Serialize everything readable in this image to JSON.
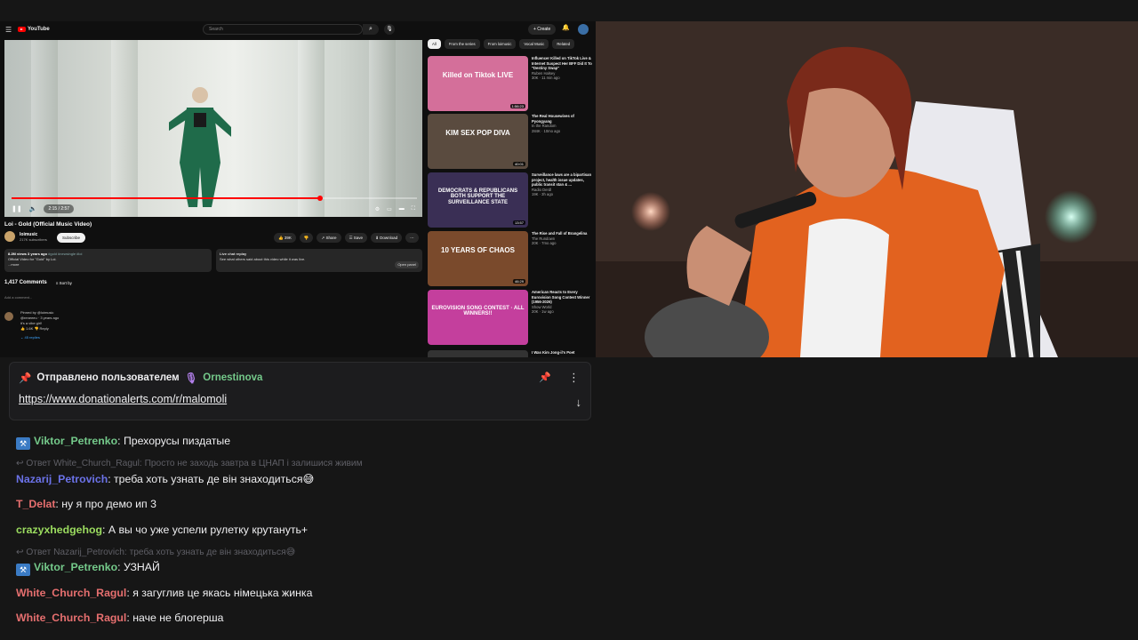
{
  "youtube": {
    "logo": "YouTube",
    "search_placeholder": "Search",
    "create_label": "+ Create",
    "player": {
      "time": "2:15 / 2:57",
      "progress": 0.76
    },
    "video_title": "Loi - Gold (Official Music Video)",
    "channel_name": "loimusic",
    "channel_subs": "217K subscribers",
    "subscribe_label": "Subscribe",
    "actions": [
      "👍 39K",
      "👎",
      "↗ Share",
      "☰ Save",
      "⬇ Download",
      "⋯"
    ],
    "description": {
      "stats": "8.2M views  3 years ago",
      "tags": "#gold #newsingle #loi",
      "text": "Official Video for \"Gold\" by Loi.",
      "more": "...more"
    },
    "live_chat": {
      "title": "Live chat replay",
      "text": "See what others said about this video while it was live.",
      "open_label": "Open panel"
    },
    "comments_count": "1,417 Comments",
    "sort_label": "Sort by",
    "add_comment": "Add a comment...",
    "pinned_comment": {
      "pinned_by": "Pinned by @loimusic",
      "author": "@reneeeu",
      "age": "3 years ago",
      "text": "it's a vibe girl!",
      "likes": "1.6K",
      "reply_label": "Reply",
      "replies": "45 replies"
    },
    "chips": [
      "All",
      "From the series",
      "From loimusic",
      "Vocal Music",
      "Related"
    ],
    "recommendations": [
      {
        "title": "Influencer Killed on TikTok Live & Internet Suspect Her BFF Did It To \"Destiny Swap\"",
        "channel": "Ruben Halsey",
        "meta": "30K · 11 min ago",
        "duration": "1:56:23",
        "thumb_text": "Killed on Tiktok LIVE",
        "bg": "#d46f9a"
      },
      {
        "title": "The Real Housewives of Pyongyang",
        "channel": "In the Random",
        "meta": "284K · 10mo ago",
        "duration": "40:01",
        "thumb_text": "KIM SEX POP DIVA",
        "bg": "#5a4b3f"
      },
      {
        "title": "Surveillance laws are a bipartisan project, health issue updates, public transit stan & ...",
        "channel": "Radio Derdl",
        "meta": "19K · 3h ago",
        "duration": "13:57",
        "thumb_text": "DEMOCRATS & REPUBLICANS BOTH SUPPORT THE SURVEILLANCE STATE",
        "bg": "#3a2f55"
      },
      {
        "title": "The Rise and Fall of Brangelina",
        "channel": "The Rundown",
        "meta": "20K · 7mo ago",
        "duration": "46:29",
        "thumb_text": "10 YEARS OF CHAOS",
        "bg": "#7a4a2c"
      },
      {
        "title": "American Reacts to Every Eurovision Song Contest Winner (1956-2026)",
        "channel": "Show World",
        "meta": "20K · 1w ago",
        "duration": "",
        "thumb_text": "EUROVISION SONG CONTEST · ALL WINNERS!!",
        "bg": "#c43f9d"
      },
      {
        "title": "I Was Kim Jong-il's Poet",
        "channel": "",
        "meta": "",
        "duration": "",
        "thumb_text": "",
        "bg": "#333"
      }
    ]
  },
  "pinned": {
    "sent_by_label": "Отправлено пользователем",
    "user": "Ornestinova",
    "link": "https://www.donationalerts.com/r/malomoli"
  },
  "chat": [
    {
      "type": "msg",
      "badge": true,
      "user": "Viktor_Petrenko",
      "color": "#74c98a",
      "text": "Прехорусы пиздатые"
    },
    {
      "type": "reply",
      "text": "↩ Ответ White_Church_Ragul: Просто не заходь завтра в ЦНАП і залишися живим"
    },
    {
      "type": "msg",
      "badge": false,
      "user": "Nazarij_Petrovich",
      "color": "#6b72e8",
      "text": "треба хоть узнать де він знаходиться😅"
    },
    {
      "type": "msg",
      "badge": false,
      "user": "T_Delat",
      "color": "#e66f6f",
      "text": "ну я про демо ип 3"
    },
    {
      "type": "msg",
      "badge": false,
      "user": "crazyxhedgehog",
      "color": "#9bdc5f",
      "text": "А вы чо уже успели рулетку крутануть+"
    },
    {
      "type": "reply",
      "text": "↩ Ответ Nazarij_Petrovich: треба хоть узнать де він знаходиться😅"
    },
    {
      "type": "msg",
      "badge": true,
      "user": "Viktor_Petrenko",
      "color": "#74c98a",
      "text": "УЗНАЙ"
    },
    {
      "type": "msg",
      "badge": false,
      "user": "White_Church_Ragul",
      "color": "#e66f6f",
      "text": "я загуглив це якась німецька жинка"
    },
    {
      "type": "msg",
      "badge": false,
      "user": "White_Church_Ragul",
      "color": "#e66f6f",
      "text": "наче не блогерша"
    }
  ]
}
